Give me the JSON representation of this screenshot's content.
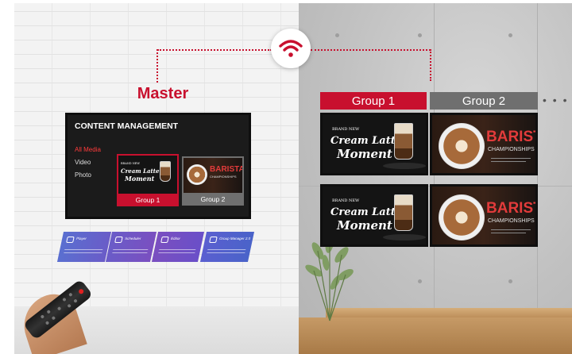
{
  "master": {
    "label": "Master"
  },
  "content_management": {
    "title": "CONTENT MANAGEMENT",
    "menu": [
      {
        "label": "All Media",
        "active": true
      },
      {
        "label": "Video",
        "active": false
      },
      {
        "label": "Photo",
        "active": false
      }
    ],
    "cards": [
      {
        "label": "Group 1",
        "selected": true
      },
      {
        "label": "Group 2",
        "selected": false
      }
    ]
  },
  "groups": {
    "group1": "Group 1",
    "group2": "Group 2",
    "more": "• • •"
  },
  "artwork": {
    "latte": {
      "brand_new": "BRAND NEW",
      "line1": "Cream Latte",
      "line2": "Moment"
    },
    "barista": {
      "word": "BARISTA",
      "sub": "CHAMPIONSHIPS"
    }
  },
  "apps": [
    {
      "name": "Player",
      "icon": "player-icon"
    },
    {
      "name": "Scheduler",
      "icon": "calendar-icon"
    },
    {
      "name": "Editor",
      "icon": "editor-icon"
    },
    {
      "name": "Group Manager 2.0",
      "icon": "group-icon"
    }
  ],
  "colors": {
    "accent": "#c8102e",
    "group2": "#6f6f6f",
    "app_gradient": [
      "#4a63c9",
      "#7a3fb3"
    ]
  },
  "icons": {
    "wifi": "wifi-icon"
  }
}
